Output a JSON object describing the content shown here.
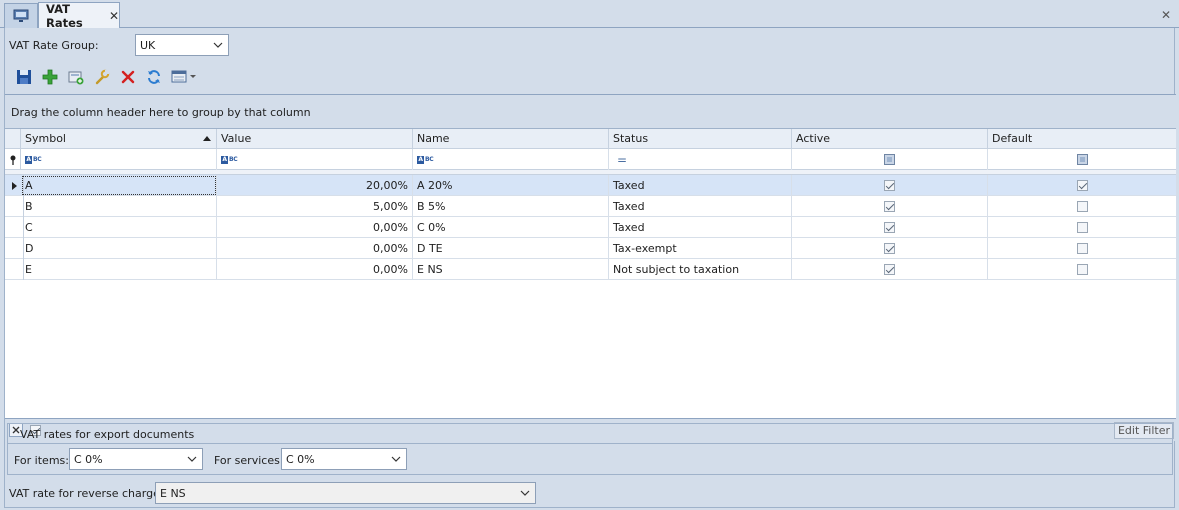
{
  "tabs": {
    "active_label": "VAT Rates",
    "close_glyph": "✕"
  },
  "rate_group": {
    "label": "VAT Rate Group:",
    "value": "UK"
  },
  "grid": {
    "group_panel_text": "Drag the column header here to group by that column",
    "columns": [
      "Symbol",
      "Value",
      "Name",
      "Status",
      "Active",
      "Default"
    ],
    "filter_status_glyph": "=",
    "rows": [
      {
        "symbol": "A",
        "value": "20,00%",
        "name": "A 20%",
        "status": "Taxed",
        "active": true,
        "default": true
      },
      {
        "symbol": "B",
        "value": "5,00%",
        "name": "B 5%",
        "status": "Taxed",
        "active": true,
        "default": false
      },
      {
        "symbol": "C",
        "value": "0,00%",
        "name": "C 0%",
        "status": "Taxed",
        "active": true,
        "default": false
      },
      {
        "symbol": "D",
        "value": "0,00%",
        "name": "D TE",
        "status": "Tax-exempt",
        "active": true,
        "default": false
      },
      {
        "symbol": "E",
        "value": "0,00%",
        "name": "E NS",
        "status": "Not subject to taxation",
        "active": true,
        "default": false
      }
    ],
    "edit_filter_label": "Edit Filter"
  },
  "export": {
    "title": "VAT rates for export documents",
    "items_label": "For items:",
    "items_value": "C 0%",
    "services_label": "For services:",
    "services_value": "C 0%"
  },
  "reverse_charge": {
    "label": "VAT rate for reverse charge:",
    "value": "E NS"
  },
  "icons": [
    "monitor-icon",
    "save-icon",
    "add-icon",
    "add-from-list-icon",
    "edit-icon",
    "delete-icon",
    "refresh-icon",
    "grid-options-icon"
  ]
}
